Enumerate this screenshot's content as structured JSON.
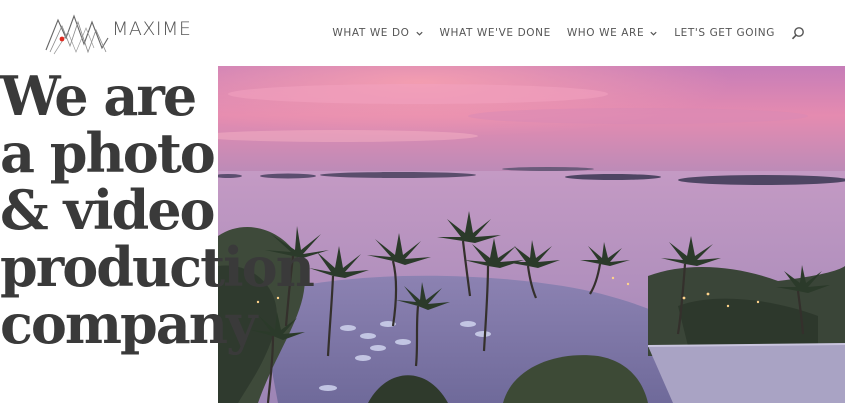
{
  "brand": {
    "name": "MAXIME",
    "logo_icon": "mountain-peaks-logo-icon",
    "accent": "#e02b20"
  },
  "nav": {
    "items": [
      {
        "label": "WHAT WE DO",
        "has_dropdown": true
      },
      {
        "label": "WHAT WE'VE DONE",
        "has_dropdown": false
      },
      {
        "label": "WHO WE ARE",
        "has_dropdown": true
      },
      {
        "label": "LET'S GET GOING",
        "has_dropdown": false
      }
    ],
    "search_icon": "search-icon",
    "text_color": "#555555"
  },
  "hero": {
    "headline_lines": [
      "We are",
      "a photo",
      "& video",
      "production",
      "company"
    ],
    "headline_color": "#3a3a3a",
    "media_description_icon": "sunset-resort-aerial-photo"
  }
}
